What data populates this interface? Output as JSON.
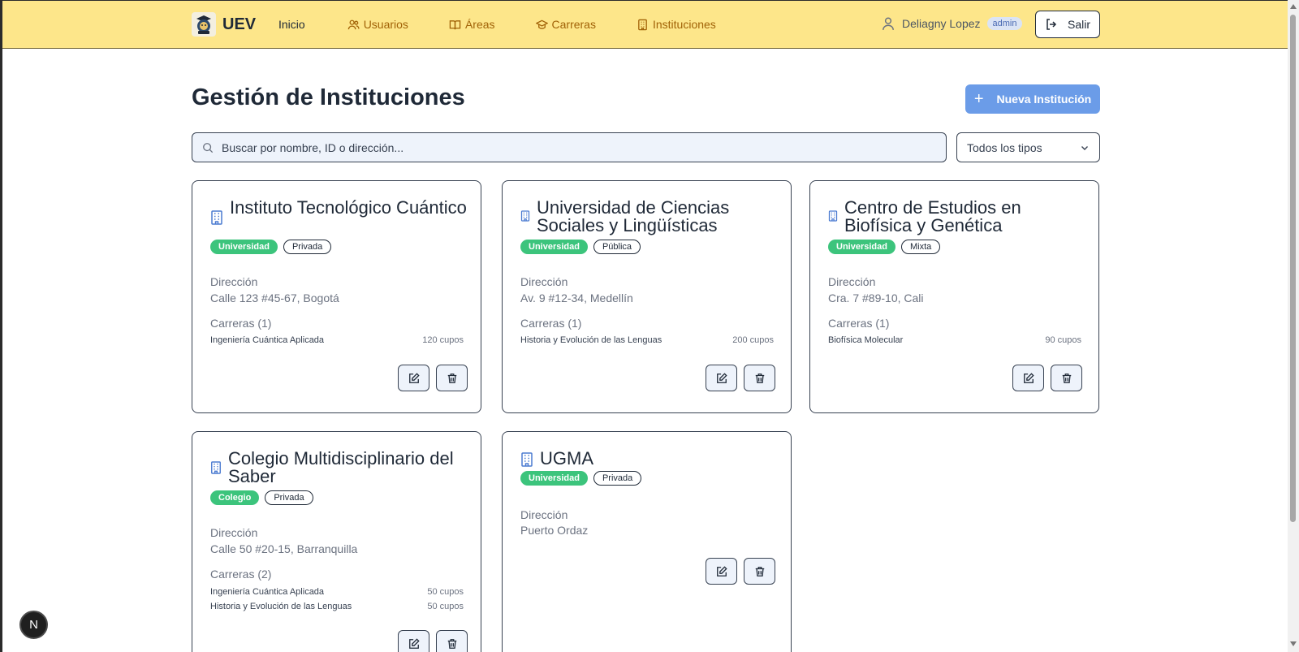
{
  "app": {
    "brand_name": "UEV"
  },
  "nav": {
    "home": "Inicio",
    "users": "Usuarios",
    "areas": "Áreas",
    "careers": "Carreras",
    "institutions": "Instituciones"
  },
  "user": {
    "name": "Deliagny Lopez",
    "role": "admin",
    "logout_label": "Salir"
  },
  "header": {
    "title": "Gestión de Instituciones",
    "new_button_label": "Nueva Institución"
  },
  "search": {
    "placeholder": "Buscar por nombre, ID o dirección...",
    "value": ""
  },
  "filter": {
    "selected": "Todos los tipos"
  },
  "labels": {
    "address": "Dirección"
  },
  "colors": {
    "navbar_bg": "#fde68a",
    "accent_blue": "#6b9ce8",
    "badge_green": "#3cc47c"
  },
  "institutions": [
    {
      "name": "Instituto Tecnológico Cuántico",
      "type": "Universidad",
      "sector": "Privada",
      "address": "Calle 123 #45-67, Bogotá",
      "careers_label": "Carreras (1)",
      "careers": [
        {
          "name": "Ingeniería Cuántica Aplicada",
          "cupos": "120 cupos"
        }
      ]
    },
    {
      "name": "Universidad de Ciencias Sociales y Lingüísticas",
      "type": "Universidad",
      "sector": "Pública",
      "address": "Av. 9 #12-34, Medellín",
      "careers_label": "Carreras (1)",
      "careers": [
        {
          "name": "Historia y Evolución de las Lenguas",
          "cupos": "200 cupos"
        }
      ]
    },
    {
      "name": "Centro de Estudios en Biofísica y Genética",
      "type": "Universidad",
      "sector": "Mixta",
      "address": "Cra. 7 #89-10, Cali",
      "careers_label": "Carreras (1)",
      "careers": [
        {
          "name": "Biofísica Molecular",
          "cupos": "90 cupos"
        }
      ]
    },
    {
      "name": "Colegio Multidisciplinario del Saber",
      "type": "Colegio",
      "sector": "Privada",
      "address": "Calle 50 #20-15, Barranquilla",
      "careers_label": "Carreras (2)",
      "careers": [
        {
          "name": "Ingeniería Cuántica Aplicada",
          "cupos": "50 cupos"
        },
        {
          "name": "Historia y Evolución de las Lenguas",
          "cupos": "50 cupos"
        }
      ]
    },
    {
      "name": "UGMA",
      "type": "Universidad",
      "sector": "Privada",
      "address": "Puerto Ordaz"
    }
  ],
  "dev_badge": "N"
}
